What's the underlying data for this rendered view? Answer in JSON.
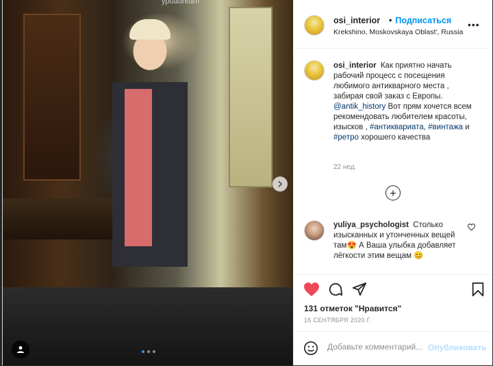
{
  "photo": {
    "watermark": "ypoadream",
    "carousel": {
      "count": 3,
      "active": 0
    }
  },
  "header": {
    "username": "osi_interior",
    "follow_label": "Подписаться",
    "separator": "•",
    "location": "Krekshino, Moskovskaya Oblast', Russia",
    "more_label": "•••"
  },
  "caption": {
    "username": "osi_interior",
    "text_1": "Как приятно начать рабочий процесс с посещения любимого антикварного места , забирая свой заказ с Европы.",
    "mention": "@antik_history",
    "text_2": "Вот прям хочется всем рекомендовать любителем красоты, изысков ,",
    "tag_1": "#антиквариата",
    "tag_2": "#винтажа",
    "and": "и",
    "tag_3": "#ретро",
    "text_3": "хорошего качества",
    "age": "22 нед."
  },
  "comment": {
    "username": "yuliya_psychologist",
    "text_1": "Столько изысканных и утонченных вещей там",
    "emoji_1": "😍",
    "text_2": "А Ваша улыбка добавляет лёгкости этим вещам",
    "emoji_2": "😊"
  },
  "actions": {
    "likes": "131 отметок \"Нравится\"",
    "date": "16 СЕНТЯБРЯ 2020 Г.",
    "liked": true
  },
  "add_comment": {
    "placeholder": "Добавьте комментарий...",
    "post_label": "Опубликовать"
  },
  "colors": {
    "accent": "#0095f6",
    "like": "#ed4956",
    "link": "#00376b",
    "muted": "#8e8e8e"
  }
}
